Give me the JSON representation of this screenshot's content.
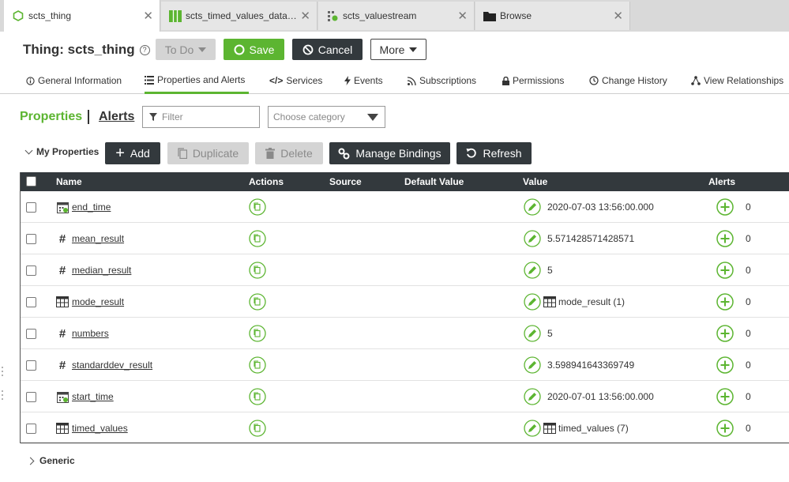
{
  "tabs": [
    {
      "label": "scts_thing",
      "icon": "thing-icon",
      "active": true
    },
    {
      "label": "scts_timed_values_datas…",
      "icon": "datashape-icon",
      "active": false
    },
    {
      "label": "scts_valuestream",
      "icon": "valuestream-icon",
      "active": false
    },
    {
      "label": "Browse",
      "icon": "folder-icon",
      "active": false
    }
  ],
  "header": {
    "title": "Thing: scts_thing",
    "todo_label": "To Do",
    "save_label": "Save",
    "cancel_label": "Cancel",
    "more_label": "More"
  },
  "nav": [
    {
      "label": "General Information",
      "icon": "info-icon"
    },
    {
      "label": "Properties and Alerts",
      "icon": "list-icon",
      "active": true
    },
    {
      "label": "Services",
      "icon": "code-icon"
    },
    {
      "label": "Events",
      "icon": "lightning-icon"
    },
    {
      "label": "Subscriptions",
      "icon": "rss-icon"
    },
    {
      "label": "Permissions",
      "icon": "lock-icon"
    },
    {
      "label": "Change History",
      "icon": "clock-icon"
    },
    {
      "label": "View Relationships",
      "icon": "relationships-icon"
    }
  ],
  "props_header": {
    "properties": "Properties",
    "alerts": "Alerts",
    "filter_placeholder": "Filter",
    "category_placeholder": "Choose category"
  },
  "toolbar": {
    "section": "My Properties",
    "add": "Add",
    "duplicate": "Duplicate",
    "delete": "Delete",
    "manage_bindings": "Manage Bindings",
    "refresh": "Refresh"
  },
  "table": {
    "columns": [
      "Name",
      "Actions",
      "Source",
      "Default Value",
      "Value",
      "Alerts"
    ],
    "rows": [
      {
        "name": "end_time",
        "type": "datetime",
        "value": "2020-07-03 13:56:00.000",
        "value_icon": "",
        "alerts": "0"
      },
      {
        "name": "mean_result",
        "type": "number",
        "value": "5.571428571428571",
        "value_icon": "",
        "alerts": "0"
      },
      {
        "name": "median_result",
        "type": "number",
        "value": "5",
        "value_icon": "",
        "alerts": "0"
      },
      {
        "name": "mode_result",
        "type": "infotable",
        "value": "mode_result (1)",
        "value_icon": "table",
        "alerts": "0"
      },
      {
        "name": "numbers",
        "type": "number",
        "value": "5",
        "value_icon": "",
        "alerts": "0"
      },
      {
        "name": "standarddev_result",
        "type": "number",
        "value": "3.598941643369749",
        "value_icon": "",
        "alerts": "0"
      },
      {
        "name": "start_time",
        "type": "datetime",
        "value": "2020-07-01 13:56:00.000",
        "value_icon": "",
        "alerts": "0"
      },
      {
        "name": "timed_values",
        "type": "infotable",
        "value": "timed_values (7)",
        "value_icon": "table",
        "alerts": "0"
      }
    ]
  },
  "generic_section": "Generic",
  "colors": {
    "accent": "#5cb531",
    "dark": "#33393d"
  }
}
